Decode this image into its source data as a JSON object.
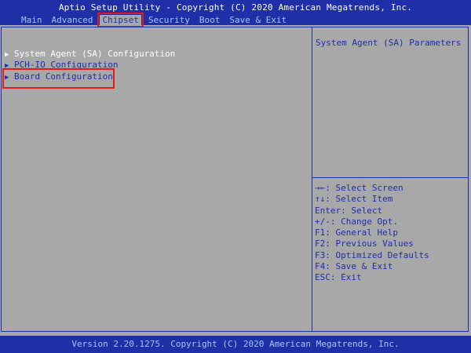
{
  "header": {
    "title": "Aptio Setup Utility - Copyright (C) 2020 American Megatrends, Inc.",
    "tabs": [
      "Main",
      "Advanced",
      "Chipset",
      "Security",
      "Boot",
      "Save & Exit"
    ],
    "active_tab": "Chipset"
  },
  "menu": {
    "items": [
      {
        "label": "System Agent (SA) Configuration",
        "icon": "right-triangle-icon"
      },
      {
        "label": "PCH-IO Configuration",
        "icon": "right-triangle-icon"
      },
      {
        "label": "Board Configuration",
        "icon": "right-triangle-icon"
      }
    ]
  },
  "help_text": "System Agent (SA) Parameters",
  "keys": [
    "→←: Select Screen",
    "↑↓: Select Item",
    "Enter: Select",
    "+/-: Change Opt.",
    "F1: General Help",
    "F2: Previous Values",
    "F3: Optimized Defaults",
    "F4: Save & Exit",
    "ESC: Exit"
  ],
  "footer": "Version 2.20.1275. Copyright (C) 2020 American Megatrends, Inc.",
  "colors": {
    "background": "#a8a8a8",
    "bar": "#1e2fa8",
    "highlight": "#e11b1b",
    "text_light": "#ffffff",
    "tab_text": "#9fc8ff"
  }
}
